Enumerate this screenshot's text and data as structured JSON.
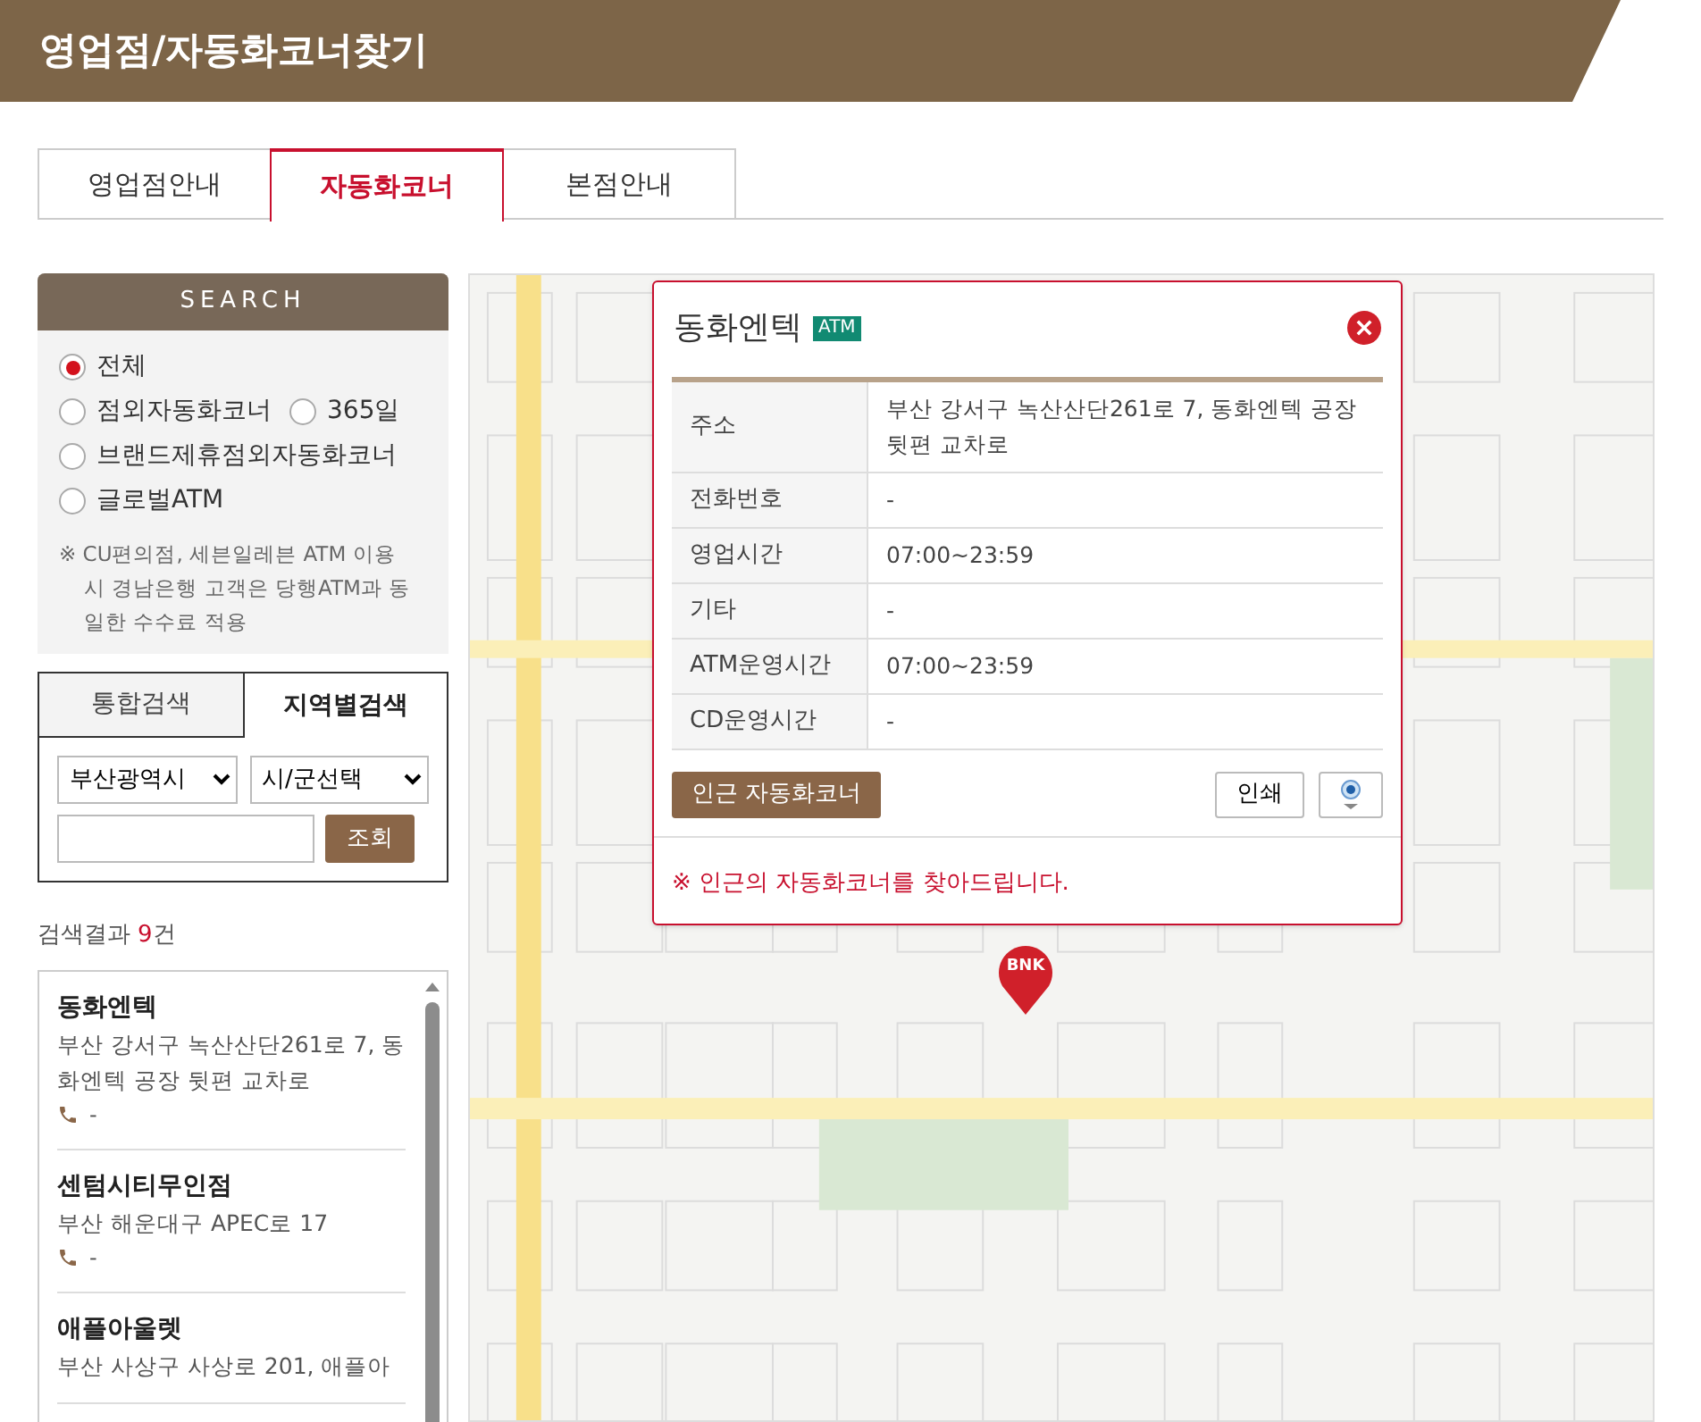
{
  "page_title": "영업점/자동화코너찾기",
  "tabs": [
    {
      "label": "영업점안내",
      "selected": false
    },
    {
      "label": "자동화코너",
      "selected": true
    },
    {
      "label": "본점안내",
      "selected": false
    }
  ],
  "search_panel": {
    "title": "SEARCH",
    "radio_rows": [
      {
        "options": [
          {
            "label": "전체",
            "checked": true
          }
        ]
      },
      {
        "options": [
          {
            "label": "점외자동화코너",
            "checked": false
          },
          {
            "label": "365일",
            "checked": false
          }
        ]
      },
      {
        "options": [
          {
            "label": "브랜드제휴점외자동화코너",
            "checked": false
          }
        ]
      },
      {
        "options": [
          {
            "label": "글로벌ATM",
            "checked": false
          }
        ]
      }
    ],
    "note": "※ CU편의점, 세븐일레븐 ATM 이용 시 경남은행 고객은 당행ATM과 동일한 수수료 적용"
  },
  "search_tabs": [
    {
      "label": "통합검색",
      "selected": false
    },
    {
      "label": "지역별검색",
      "selected": true
    }
  ],
  "region_search": {
    "city": "부산광역시",
    "district": "시/군선택",
    "button": "조회"
  },
  "results": {
    "label": "검색결과",
    "count": "9",
    "unit": "건",
    "items": [
      {
        "name": "동화엔텍",
        "address": "부산 강서구 녹산산단261로 7, 동화엔텍 공장 뒷편 교차로",
        "phone": "-"
      },
      {
        "name": "센텀시티무인점",
        "address": "부산 해운대구 APEC로 17",
        "phone": "-"
      },
      {
        "name": "애플아울렛",
        "address": "부산 사상구 사상로 201, 애플아"
      }
    ]
  },
  "map": {
    "marker": "BNK",
    "popup": {
      "title": "동화엔텍",
      "badge": "ATM",
      "rows": [
        {
          "label": "주소",
          "value": "부산 강서구 녹산산단261로 7, 동화엔텍 공장 뒷편 교차로"
        },
        {
          "label": "전화번호",
          "value": "-"
        },
        {
          "label": "영업시간",
          "value": "07:00~23:59"
        },
        {
          "label": "기타",
          "value": "-"
        },
        {
          "label": "ATM운영시간",
          "value": "07:00~23:59"
        },
        {
          "label": "CD운영시간",
          "value": "-"
        }
      ],
      "nearby_button": "인근 자동화코너",
      "print_button": "인쇄",
      "notice": "※ 인근의 자동화코너를 찾아드립니다."
    }
  }
}
